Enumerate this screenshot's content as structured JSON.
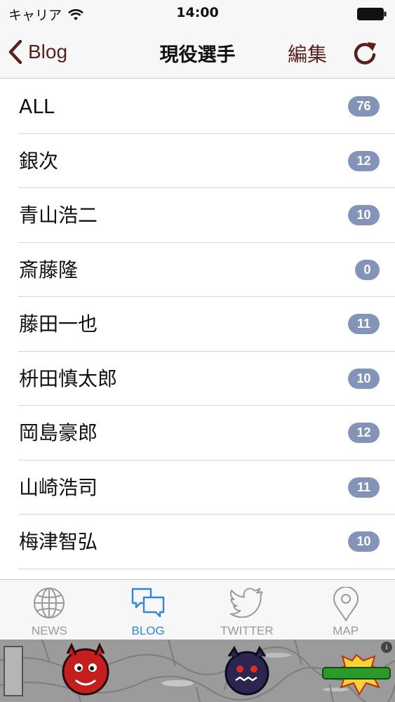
{
  "status_bar": {
    "carrier": "キャリア",
    "time": "14:00"
  },
  "nav": {
    "back_label": "Blog",
    "title": "現役選手",
    "edit_label": "編集"
  },
  "list": {
    "items": [
      {
        "label": "ALL",
        "count": "76"
      },
      {
        "label": "銀次",
        "count": "12"
      },
      {
        "label": "青山浩二",
        "count": "10"
      },
      {
        "label": "斎藤隆",
        "count": "0"
      },
      {
        "label": "藤田一也",
        "count": "11"
      },
      {
        "label": "枡田慎太郎",
        "count": "10"
      },
      {
        "label": "岡島豪郎",
        "count": "12"
      },
      {
        "label": "山崎浩司",
        "count": "11"
      },
      {
        "label": "梅津智弘",
        "count": "10"
      }
    ]
  },
  "tabs": [
    {
      "label": "NEWS",
      "icon": "globe-icon",
      "active": false
    },
    {
      "label": "BLOG",
      "icon": "chat-bubbles-icon",
      "active": true
    },
    {
      "label": "TWITTER",
      "icon": "twitter-bird-icon",
      "active": false
    },
    {
      "label": "MAP",
      "icon": "map-pin-icon",
      "active": false
    }
  ],
  "colors": {
    "accent": "#5a1f1f",
    "badge": "#8494b8",
    "tab_active": "#2e88d8",
    "tab_inactive": "#9a9a9a"
  },
  "ad": {
    "info_label": "i"
  }
}
